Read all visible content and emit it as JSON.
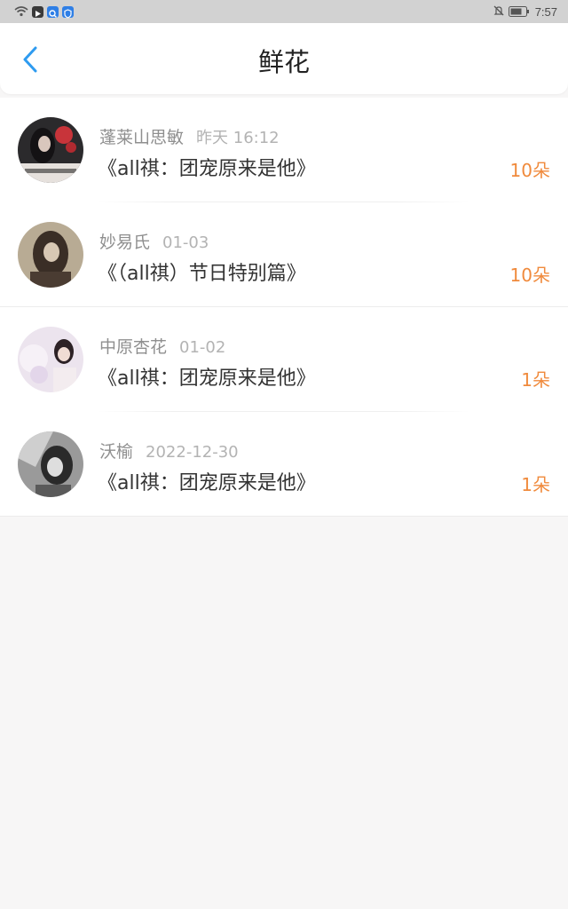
{
  "status_bar": {
    "time": "7:57",
    "icons": [
      "wifi-icon",
      "app-icon-media",
      "app-icon-search",
      "app-icon-shield",
      "mute-icon",
      "battery-icon"
    ]
  },
  "header": {
    "title": "鲜花",
    "back_icon": "chevron-left-icon"
  },
  "colors": {
    "accent_back": "#2e9bf0",
    "count_orange": "#f08a3c",
    "status_bar_bg": "#d2d2d2",
    "page_bg": "#f7f6f6"
  },
  "records": [
    {
      "user": "蓬莱山思敏",
      "time": "昨天 16:12",
      "title": "《all祺：团宠原来是他》",
      "count": "10朵"
    },
    {
      "user": "妙易氏",
      "time": "01-03",
      "title": "《（all祺）节日特别篇》",
      "count": "10朵"
    },
    {
      "user": "中原杏花",
      "time": "01-02",
      "title": "《all祺：团宠原来是他》",
      "count": "1朵"
    },
    {
      "user": "沃榆",
      "time": "2022-12-30",
      "title": "《all祺：团宠原来是他》",
      "count": "1朵"
    }
  ]
}
